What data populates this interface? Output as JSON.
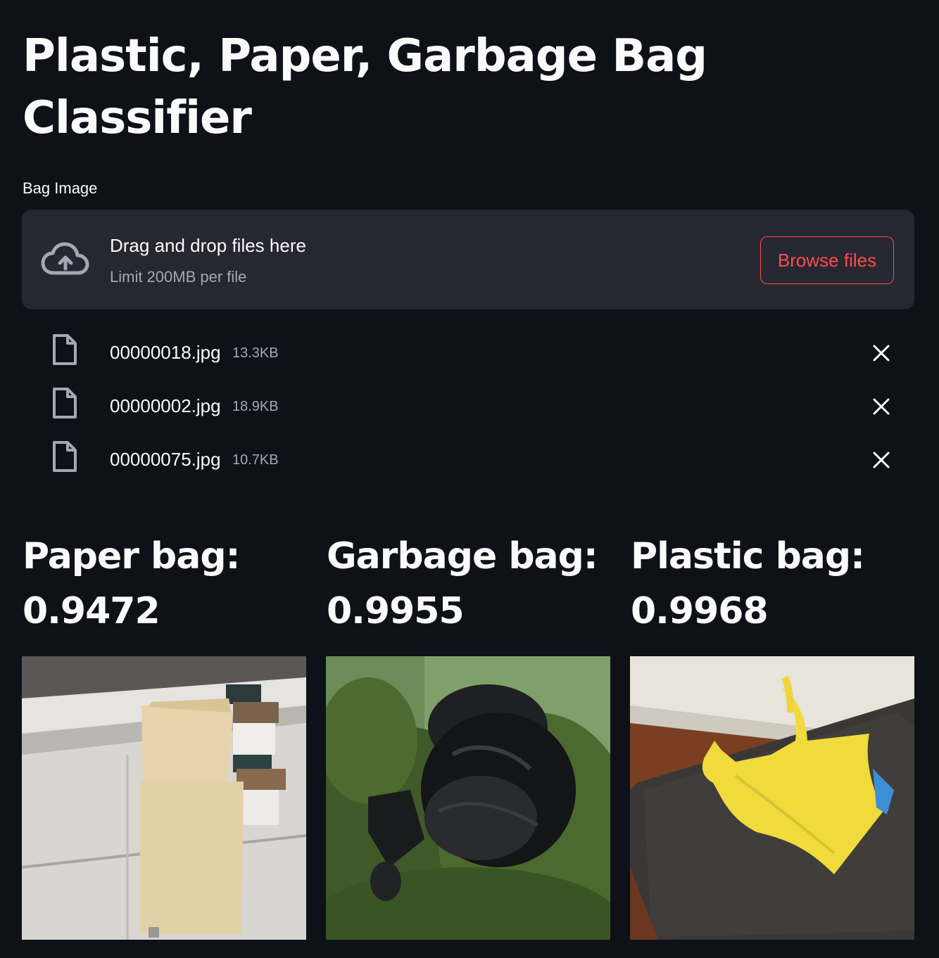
{
  "page": {
    "title": "Plastic, Paper, Garbage Bag Classifier"
  },
  "uploader": {
    "label": "Bag Image",
    "drag_text": "Drag and drop files here",
    "limit_text": "Limit 200MB per file",
    "browse_label": "Browse files",
    "icon": "cloud-upload-icon",
    "accent_color": "#ff4b4b",
    "files": [
      {
        "name": "00000018.jpg",
        "size": "13.3KB"
      },
      {
        "name": "00000002.jpg",
        "size": "18.9KB"
      },
      {
        "name": "00000075.jpg",
        "size": "10.7KB"
      }
    ]
  },
  "results": [
    {
      "label": "Paper bag:",
      "score": "0.9472",
      "image": "paper-bag-photo"
    },
    {
      "label": "Garbage bag:",
      "score": "0.9955",
      "image": "garbage-bag-photo"
    },
    {
      "label": "Plastic bag:",
      "score": "0.9968",
      "image": "plastic-bag-photo"
    }
  ]
}
